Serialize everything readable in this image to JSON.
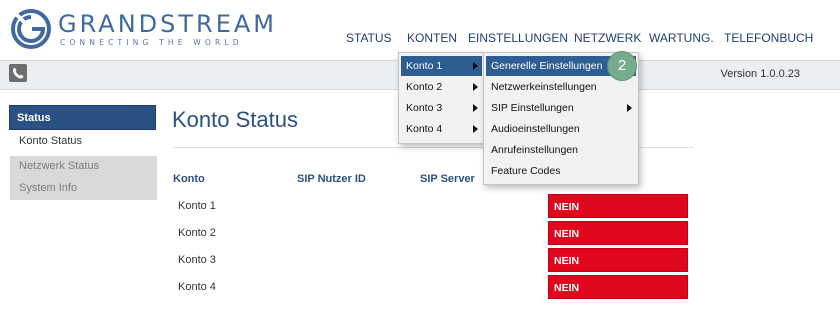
{
  "brand": {
    "name": "GRANDSTREAM",
    "tagline": "CONNECTING THE WORLD"
  },
  "topnav": [
    "STATUS",
    "KONTEN",
    "EINSTELLUNGEN",
    "NETZWERK",
    "WARTUNG.",
    "TELEFONBUCH"
  ],
  "version": "Version 1.0.0.23",
  "sidebar": {
    "header": "Status",
    "items": [
      "Konto Status",
      "Netzwerk Status",
      "System Info"
    ]
  },
  "page_title": "Konto Status",
  "table": {
    "columns": [
      "Konto",
      "SIP Nutzer ID",
      "SIP Server"
    ],
    "rows": [
      {
        "konto": "Konto 1",
        "status": "NEIN"
      },
      {
        "konto": "Konto 2",
        "status": "NEIN"
      },
      {
        "konto": "Konto 3",
        "status": "NEIN"
      },
      {
        "konto": "Konto 4",
        "status": "NEIN"
      }
    ]
  },
  "menu_konten": [
    "Konto 1",
    "Konto 2",
    "Konto 3",
    "Konto 4"
  ],
  "menu_konto1": [
    "Generelle Einstellungen",
    "Netzwerkeinstellungen",
    "SIP Einstellungen",
    "Audioeinstellungen",
    "Anrufeinstellungen",
    "Feature Codes"
  ],
  "step_badge": "2",
  "colors": {
    "brand_blue": "#2b5082",
    "status_red": "#e0061d",
    "step_green": "#76ac8c",
    "menu_highlight": "#2e5d93"
  }
}
